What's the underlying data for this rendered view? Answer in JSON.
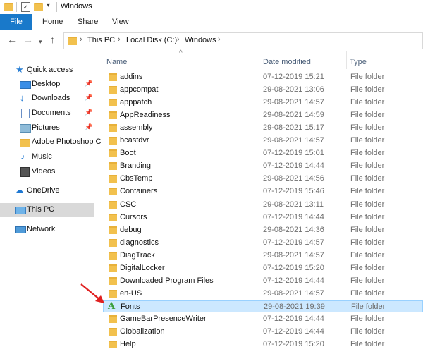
{
  "window": {
    "title": "Windows"
  },
  "ribbon": {
    "file": "File",
    "tabs": [
      "Home",
      "Share",
      "View"
    ]
  },
  "address": {
    "crumbs": [
      "This PC",
      "Local Disk (C:)",
      "Windows"
    ]
  },
  "nav": {
    "quick_access": "Quick access",
    "items": [
      "Desktop",
      "Downloads",
      "Documents",
      "Pictures",
      "Adobe Photoshop C",
      "Music",
      "Videos"
    ],
    "onedrive": "OneDrive",
    "this_pc": "This PC",
    "network": "Network"
  },
  "columns": {
    "name": "Name",
    "date": "Date modified",
    "type": "Type"
  },
  "files": [
    {
      "name": "addins",
      "date": "07-12-2019 15:21",
      "type": "File folder"
    },
    {
      "name": "appcompat",
      "date": "29-08-2021 13:06",
      "type": "File folder"
    },
    {
      "name": "apppatch",
      "date": "29-08-2021 14:57",
      "type": "File folder"
    },
    {
      "name": "AppReadiness",
      "date": "29-08-2021 14:59",
      "type": "File folder"
    },
    {
      "name": "assembly",
      "date": "29-08-2021 15:17",
      "type": "File folder"
    },
    {
      "name": "bcastdvr",
      "date": "29-08-2021 14:57",
      "type": "File folder"
    },
    {
      "name": "Boot",
      "date": "07-12-2019 15:01",
      "type": "File folder"
    },
    {
      "name": "Branding",
      "date": "07-12-2019 14:44",
      "type": "File folder"
    },
    {
      "name": "CbsTemp",
      "date": "29-08-2021 14:56",
      "type": "File folder"
    },
    {
      "name": "Containers",
      "date": "07-12-2019 15:46",
      "type": "File folder"
    },
    {
      "name": "CSC",
      "date": "29-08-2021 13:11",
      "type": "File folder"
    },
    {
      "name": "Cursors",
      "date": "07-12-2019 14:44",
      "type": "File folder"
    },
    {
      "name": "debug",
      "date": "29-08-2021 14:36",
      "type": "File folder"
    },
    {
      "name": "diagnostics",
      "date": "07-12-2019 14:57",
      "type": "File folder"
    },
    {
      "name": "DiagTrack",
      "date": "29-08-2021 14:57",
      "type": "File folder"
    },
    {
      "name": "DigitalLocker",
      "date": "07-12-2019 15:20",
      "type": "File folder"
    },
    {
      "name": "Downloaded Program Files",
      "date": "07-12-2019 14:44",
      "type": "File folder"
    },
    {
      "name": "en-US",
      "date": "29-08-2021 14:57",
      "type": "File folder"
    },
    {
      "name": "Fonts",
      "date": "29-08-2021 19:39",
      "type": "File folder"
    },
    {
      "name": "GameBarPresenceWriter",
      "date": "07-12-2019 14:44",
      "type": "File folder"
    },
    {
      "name": "Globalization",
      "date": "07-12-2019 14:44",
      "type": "File folder"
    },
    {
      "name": "Help",
      "date": "07-12-2019 15:20",
      "type": "File folder"
    }
  ]
}
